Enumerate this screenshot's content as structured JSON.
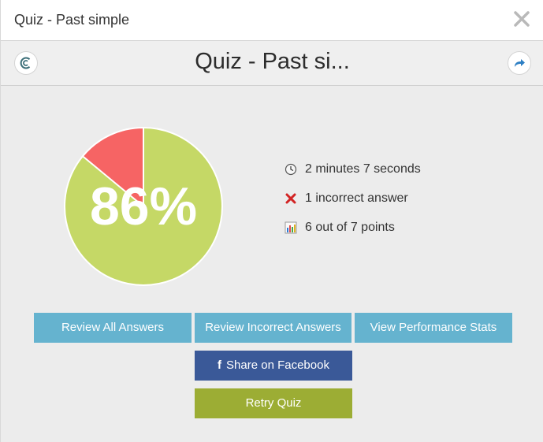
{
  "window": {
    "title": "Quiz - Past simple"
  },
  "header": {
    "title": "Quiz - Past si..."
  },
  "result": {
    "percent_label": "86%",
    "percent": 86,
    "colors": {
      "correct": "#c5d866",
      "incorrect": "#f66464"
    }
  },
  "stats": {
    "time": "2 minutes 7 seconds",
    "incorrect": "1 incorrect answer",
    "points": "6 out of 7 points"
  },
  "buttons": {
    "review_all": "Review All Answers",
    "review_incorrect": "Review Incorrect Answers",
    "performance_stats": "View Performance Stats",
    "share_facebook": "Share on Facebook",
    "retry": "Retry Quiz"
  },
  "icons": {
    "close": "close-icon",
    "back": "cycle-logo-icon",
    "share": "share-arrow-icon",
    "clock": "clock-icon",
    "wrong": "red-x-icon",
    "chart": "bar-chart-icon",
    "facebook": "facebook-icon"
  }
}
